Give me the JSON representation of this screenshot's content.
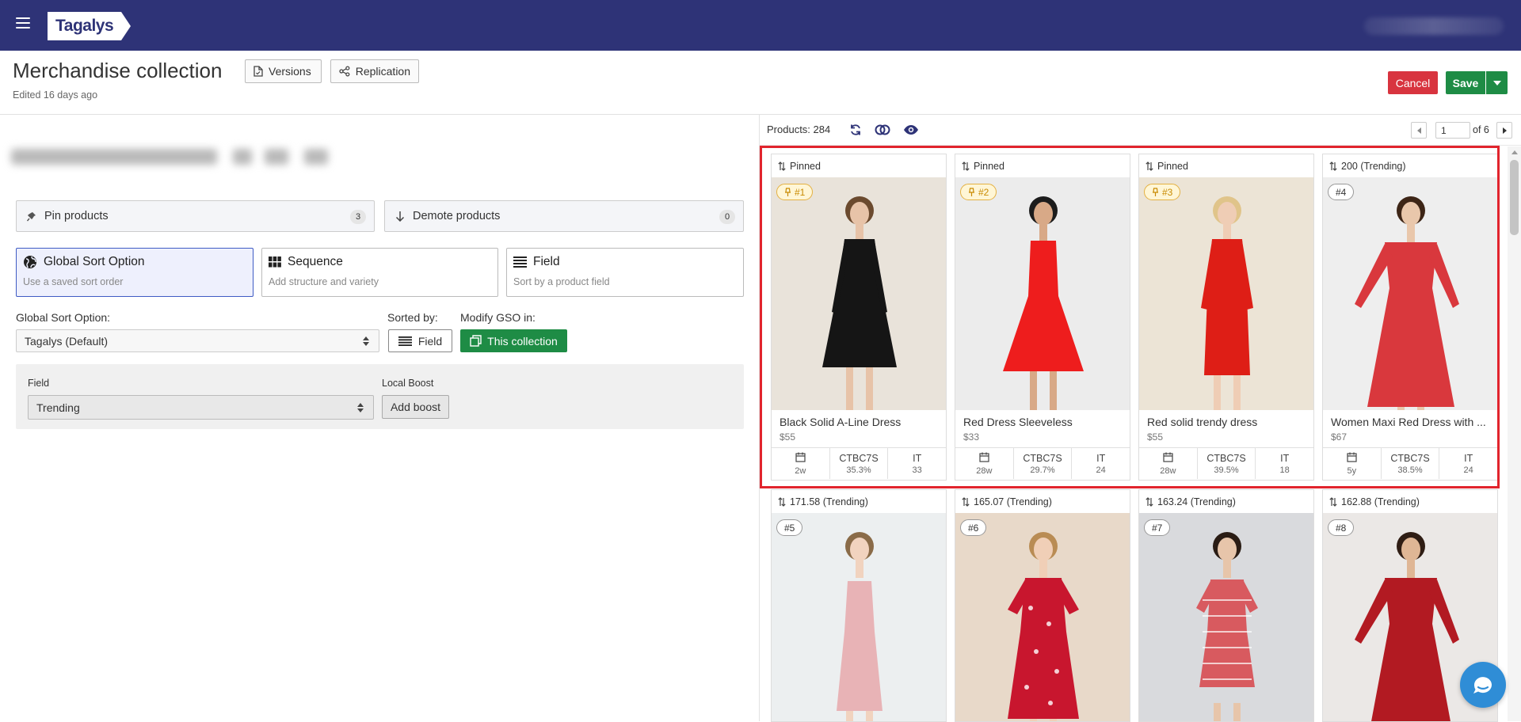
{
  "topbar": {
    "logo": "Tagalys"
  },
  "header": {
    "title": "Merchandise collection",
    "edited": "Edited 16 days ago",
    "versions_label": "Versions",
    "replication_label": "Replication",
    "cancel_label": "Cancel",
    "save_label": "Save"
  },
  "left": {
    "pin": {
      "label": "Pin products",
      "count": "3"
    },
    "demote": {
      "label": "Demote products",
      "count": "0"
    },
    "sort_options": [
      {
        "title": "Global Sort Option",
        "desc": "Use a saved sort order",
        "icon": "globe-icon"
      },
      {
        "title": "Sequence",
        "desc": "Add structure and variety",
        "icon": "grid-icon"
      },
      {
        "title": "Field",
        "desc": "Sort by a product field",
        "icon": "list-icon"
      }
    ],
    "gso_label": "Global Sort Option:",
    "gso_value": "Tagalys (Default)",
    "sorted_by_label": "Sorted by:",
    "sorted_by_value": "Field",
    "modify_label": "Modify GSO in:",
    "modify_value": "This collection",
    "field_label": "Field",
    "field_value": "Trending",
    "boost_label": "Local Boost",
    "boost_button": "Add boost"
  },
  "right": {
    "products_label": "Products:",
    "products_count": "284",
    "page": "1",
    "page_of": "of 6"
  },
  "colors": {
    "brand": "#2e3377",
    "save": "#1e8c45",
    "cancel": "#d8343f",
    "highlight": "#e1242d",
    "pinned_badge": "#e4b142"
  },
  "products": [
    {
      "head": "Pinned",
      "rank": "#1",
      "pinned": true,
      "name": "Black Solid A-Line Dress",
      "price": "$55",
      "age": "2w",
      "k2": "CTBC7S",
      "v2": "35.3%",
      "k3": "IT",
      "v3": "33"
    },
    {
      "head": "Pinned",
      "rank": "#2",
      "pinned": true,
      "name": "Red Dress Sleeveless",
      "price": "$33",
      "age": "28w",
      "k2": "CTBC7S",
      "v2": "29.7%",
      "k3": "IT",
      "v3": "24"
    },
    {
      "head": "Pinned",
      "rank": "#3",
      "pinned": true,
      "name": "Red solid trendy dress",
      "price": "$55",
      "age": "28w",
      "k2": "CTBC7S",
      "v2": "39.5%",
      "k3": "IT",
      "v3": "18"
    },
    {
      "head": "200 (Trending)",
      "rank": "#4",
      "pinned": false,
      "name": "Women Maxi Red Dress with ...",
      "price": "$67",
      "age": "5y",
      "k2": "CTBC7S",
      "v2": "38.5%",
      "k3": "IT",
      "v3": "24"
    },
    {
      "head": "171.58 (Trending)",
      "rank": "#5",
      "pinned": false
    },
    {
      "head": "165.07 (Trending)",
      "rank": "#6",
      "pinned": false
    },
    {
      "head": "163.24 (Trending)",
      "rank": "#7",
      "pinned": false
    },
    {
      "head": "162.88 (Trending)",
      "rank": "#8",
      "pinned": false
    }
  ]
}
